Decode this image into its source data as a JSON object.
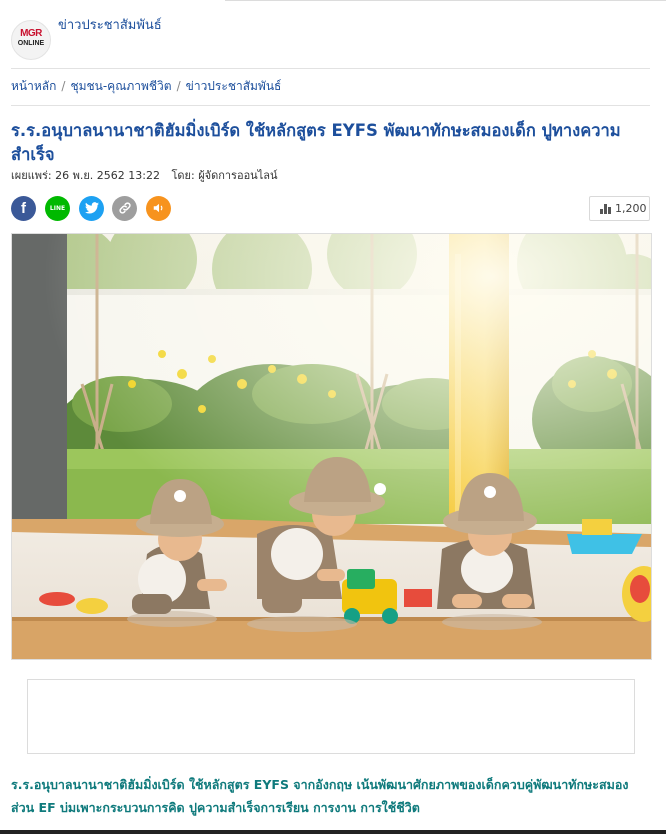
{
  "header": {
    "logo": {
      "line1": "MGR",
      "line2": "ONLINE"
    },
    "section_title": "ข่าวประชาสัมพันธ์"
  },
  "breadcrumb": {
    "items": [
      "หน้าหลัก",
      "ชุมชน-คุณภาพชีวิต",
      "ข่าวประชาสัมพันธ์"
    ],
    "separator": "/"
  },
  "article": {
    "headline": "ร.ร.อนุบาลนานาชาติฮัมมิ่งเบิร์ด ใช้หลักสูตร EYFS พัฒนาทักษะสมองเด็ก ปูทางความสำเร็จ",
    "published_label": "เผยแพร่:",
    "published_date": "26 พ.ย. 2562 13:22",
    "author_label": "โดย:",
    "author": "ผู้จัดการออนไลน์",
    "lead": "ร.ร.อนุบาลนานาชาติฮัมมิ่งเบิร์ด ใช้หลักสูตร EYFS จากอังกฤษ เน้นพัฒนาศักยภาพของเด็กควบคู่พัฒนาทักษะสมองส่วน EF บ่มเพาะกระบวนการคิด ปูความสำเร็จการเรียน การงาน การใช้ชีวิต"
  },
  "share": {
    "buttons": [
      {
        "name": "facebook",
        "icon": "facebook-icon",
        "glyph": "f",
        "color": "#3b5998"
      },
      {
        "name": "line",
        "icon": "line-icon",
        "glyph": "LINE",
        "color": "#00b900"
      },
      {
        "name": "twitter",
        "icon": "twitter-icon",
        "glyph": "🐦",
        "color": "#1da1f2"
      },
      {
        "name": "copy-link",
        "icon": "link-icon",
        "glyph": "🔗",
        "color": "#9e9e9e"
      },
      {
        "name": "listen",
        "icon": "speaker-icon",
        "glyph": "🔈",
        "color": "#f7931e"
      }
    ],
    "views": "1,200"
  },
  "colors": {
    "headline": "#1d4f9c",
    "lead": "#0f7a7c",
    "facebook": "#3b5998",
    "line": "#00b900",
    "twitter": "#1da1f2",
    "link": "#9e9e9e",
    "speaker": "#f7931e"
  },
  "photo": {
    "description_icon": "photo-icon"
  }
}
